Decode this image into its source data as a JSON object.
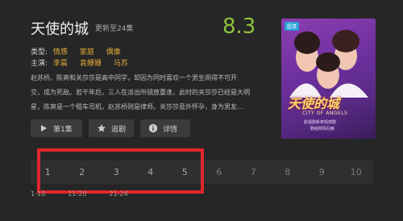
{
  "show": {
    "title": "天使的城",
    "update_status": "更新至24集",
    "score": "8.3",
    "type_label": "类型:",
    "genres": [
      "情感",
      "家庭",
      "偶像"
    ],
    "cast_label": "主演:",
    "cast": [
      "李晨",
      "袁姗姗",
      "马苏"
    ],
    "description_lines": [
      "赵苏桥、陈爽和关莎莎是高中同学，却因为同时喜欢一个男生闹得不可开",
      "交，成为死敌。若干年后，三人在派出所镜放重逢，此时的关莎莎已经是大明",
      "星，陈爽是一个租车司机，赵苏桥则是律师。关莎莎意外怀孕，身为男友..."
    ]
  },
  "actions": {
    "play_label": "第1集",
    "favorite_label": "追剧",
    "detail_label": "详情"
  },
  "poster": {
    "tag": "超清",
    "title_art": "天使的城",
    "english_title": "CITY OF ANGELS",
    "line1": "影视剧新奇情感剧",
    "line2": "剧组倾情巨献"
  },
  "episodes": [
    "1",
    "2",
    "3",
    "4",
    "5",
    "6",
    "7",
    "8",
    "9",
    "10"
  ],
  "episode_ranges": [
    "1-10",
    "11-20",
    "21-24"
  ],
  "colors": {
    "accent_yellow": "#e0a93a",
    "score_green": "#8ec23d",
    "highlight_red": "#e0262b"
  },
  "icons": {
    "play": "play-icon",
    "favorite": "star-icon",
    "detail": "info-icon"
  }
}
